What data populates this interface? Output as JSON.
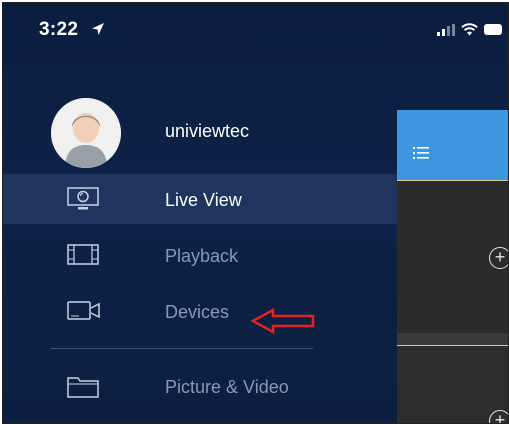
{
  "status_bar": {
    "time": "3:22",
    "location_icon": "location-arrow-icon",
    "signal_icon": "cellular-signal-icon",
    "wifi_icon": "wifi-icon",
    "battery_icon": "battery-icon"
  },
  "profile": {
    "avatar_icon": "user-avatar-icon",
    "username": "univiewtec"
  },
  "menu": {
    "items": [
      {
        "label": "Live View",
        "icon": "monitor-icon",
        "active": true
      },
      {
        "label": "Playback",
        "icon": "film-icon",
        "active": false
      },
      {
        "label": "Devices",
        "icon": "camera-icon",
        "active": false
      },
      {
        "label": "Picture & Video",
        "icon": "folder-icon",
        "active": false
      }
    ]
  },
  "annotation": {
    "icon": "red-arrow-icon",
    "color": "#e32222"
  },
  "background_app": {
    "header_color": "#3e95e0",
    "menu_icon": "hamburger-icon",
    "add_icon": "add-circle-icon"
  },
  "colors": {
    "drawer_bg": "#0d2247",
    "active_row": "#233764",
    "active_text": "#ffffff",
    "inactive_text": "#8a98b4"
  }
}
